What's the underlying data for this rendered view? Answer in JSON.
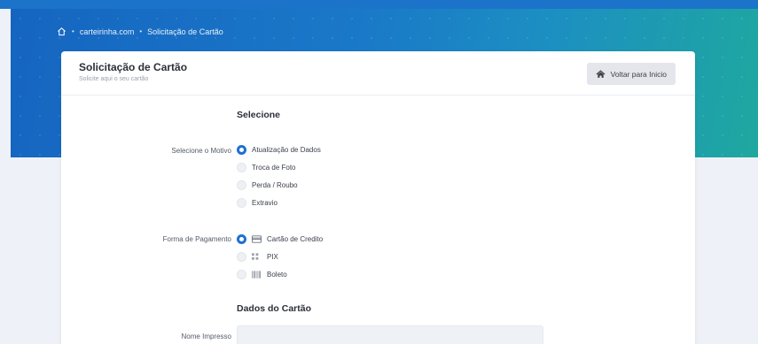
{
  "breadcrumb": {
    "items": [
      "carteirinha.com",
      "Solicitação de Cartão"
    ],
    "separator": "•"
  },
  "header": {
    "title": "Solicitação de Cartão",
    "subtitle": "Solicite aqui o seu cartão",
    "back_button": "Voltar para Inicio"
  },
  "form": {
    "section_select": "Selecione",
    "motivo": {
      "label": "Selecione o Motivo",
      "options": [
        "Atualização de Dados",
        "Troca de Foto",
        "Perda / Roubo",
        "Extravio"
      ],
      "selected": "Atualização de Dados"
    },
    "pagamento": {
      "label": "Forma de Pagamento",
      "options": [
        "Cartão de Credito",
        "PIX",
        "Boleto"
      ],
      "icons": [
        "credit-card-icon",
        "qr-code-icon",
        "barcode-icon"
      ],
      "selected": "Cartão de Credito"
    },
    "section_card": "Dados do Cartão",
    "nome_impresso": {
      "label": "Nome Impresso",
      "value": ""
    }
  },
  "colors": {
    "hero_start": "#1565c0",
    "hero_end": "#1fa89f",
    "accent": "#1f6fd1",
    "background": "#eef1f7"
  }
}
